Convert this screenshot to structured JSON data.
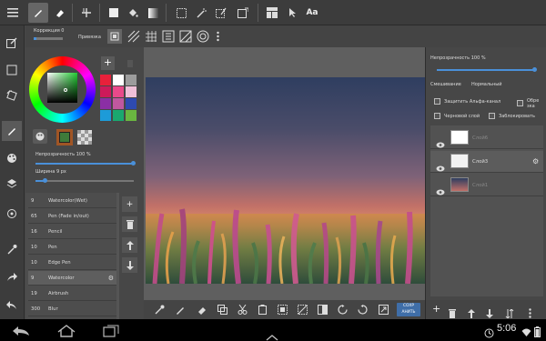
{
  "subtoolbar": {
    "correction_label": "Коррекция 0",
    "snap_label": "Привязка"
  },
  "left_panel": {
    "opacity_label": "Непрозрачность 100 %",
    "width_label": "Ширина 9 px",
    "brushes": [
      {
        "size": "9",
        "name": "Watercolor(Wet)"
      },
      {
        "size": "65",
        "name": "Pen (Fade in/out)"
      },
      {
        "size": "16",
        "name": "Pencil"
      },
      {
        "size": "10",
        "name": "Pen"
      },
      {
        "size": "10",
        "name": "Edge Pen"
      },
      {
        "size": "9",
        "name": "Watercolor"
      },
      {
        "size": "19",
        "name": "Airbrush"
      },
      {
        "size": "300",
        "name": "Blur"
      }
    ],
    "palette": [
      "#e8203a",
      "#ffffff",
      "#9c9c9c",
      "#cd1a5a",
      "#e94a8a",
      "#f0c0d8",
      "#8b2fa5",
      "#c0589f",
      "#2e4ab0",
      "#1d9bd8",
      "#1aa86f",
      "#6ab640"
    ],
    "current_color": "#3f7a3a",
    "secondary_color": "#a05525"
  },
  "right_panel": {
    "opacity_label": "Непрозрачность 100 %",
    "blend_label": "Смешивание",
    "blend_value": "Нормальный",
    "protect_alpha": "Защитить Альфа-канал",
    "clip_short": "Обре зка",
    "draft_layer": "Черновой слой",
    "locked": "Заблокировать",
    "layers": [
      {
        "name": "Слой6",
        "selected": false
      },
      {
        "name": "Слой3",
        "selected": true
      },
      {
        "name": "Слой1",
        "selected": false
      }
    ]
  },
  "bottom_toolbar": {
    "save_label_1": "СОХР",
    "save_label_2": "АНИТЬ"
  },
  "statusbar": {
    "time": "5:06"
  },
  "icons": {
    "menu": "hamburger-icon",
    "brush": "brush-icon",
    "eraser": "eraser-icon",
    "layers": "layers-icon"
  }
}
